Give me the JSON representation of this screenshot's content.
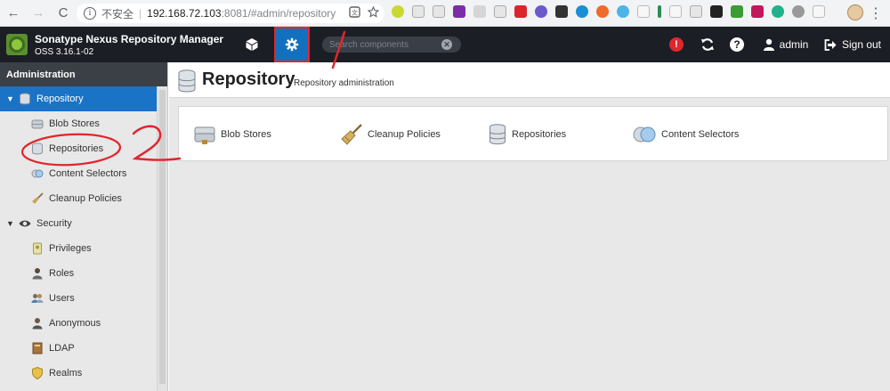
{
  "browser": {
    "nav": {
      "back": "←",
      "forward": "→",
      "reload": "C"
    },
    "security_label": "不安全",
    "url_host": "192.168.72.103",
    "url_path": ":8081/#admin/repository",
    "menu": "⋮"
  },
  "header": {
    "brand_title": "Sonatype Nexus Repository Manager",
    "brand_version": "OSS 3.16.1-02",
    "search_placeholder": "Search components",
    "alert_glyph": "!",
    "help_glyph": "?",
    "username": "admin",
    "signout_label": "Sign out"
  },
  "sidebar": {
    "title": "Administration",
    "items": [
      {
        "label": "Repository",
        "icon": "database-icon",
        "caret": "▼"
      },
      {
        "label": "Blob Stores",
        "icon": "blob-store-icon"
      },
      {
        "label": "Repositories",
        "icon": "database-icon"
      },
      {
        "label": "Content Selectors",
        "icon": "content-selector-icon"
      },
      {
        "label": "Cleanup Policies",
        "icon": "broom-icon"
      },
      {
        "label": "Security",
        "icon": "eye-icon",
        "caret": "▼"
      },
      {
        "label": "Privileges",
        "icon": "privilege-icon"
      },
      {
        "label": "Roles",
        "icon": "role-icon"
      },
      {
        "label": "Users",
        "icon": "users-icon"
      },
      {
        "label": "Anonymous",
        "icon": "anonymous-icon"
      },
      {
        "label": "LDAP",
        "icon": "book-icon"
      },
      {
        "label": "Realms",
        "icon": "shield-icon"
      }
    ]
  },
  "main": {
    "title": "Repository",
    "subtitle": "Repository administration",
    "features": [
      {
        "label": "Blob Stores",
        "icon": "blob-store-icon"
      },
      {
        "label": "Cleanup Policies",
        "icon": "broom-icon"
      },
      {
        "label": "Repositories",
        "icon": "database-icon"
      },
      {
        "label": "Content Selectors",
        "icon": "content-selector-icon"
      }
    ]
  },
  "annotations": {
    "step1": "1",
    "step2": "2",
    "color": "#e0262d"
  },
  "colors": {
    "accent": "#1a73c6",
    "header_bg": "#1b1e24",
    "alert": "#e0262d"
  }
}
